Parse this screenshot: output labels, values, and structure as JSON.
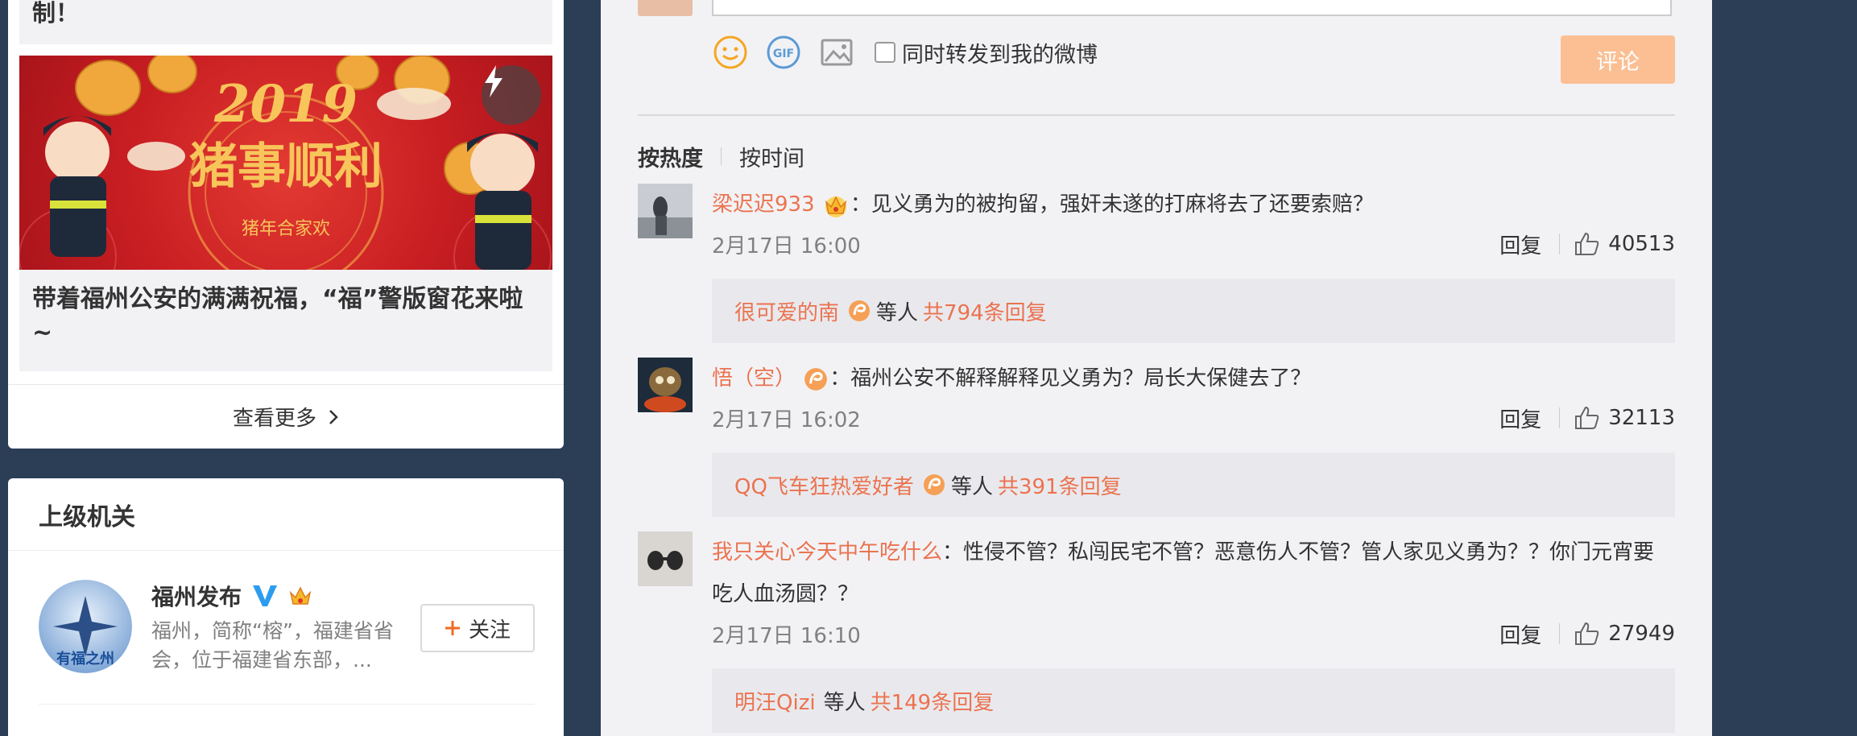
{
  "left": {
    "prev_title": "制！",
    "banner_caption": "带着福州公安的满满祝福，“福”警版窗花来啦~",
    "banner_art": {
      "year": "2019",
      "slogan": "猪事顺利",
      "sub": "猪年合家欢"
    },
    "more_label": "查看更多",
    "superior": {
      "header": "上级机关",
      "name": "福州发布",
      "desc": "福州，简称“榕”，福建省省会，位于福建省东部，...",
      "follow_label": "关注",
      "avatar_caption": "有福之州"
    }
  },
  "composer": {
    "repost_label": "同时转发到我的微博",
    "submit_label": "评论",
    "icons": [
      "smiley-icon",
      "gif-icon",
      "image-icon"
    ]
  },
  "sort": {
    "hot": "按热度",
    "time": "按时间"
  },
  "comments": [
    {
      "user": "梁迟迟933",
      "text": "：见义勇为的被拘留，强奸未遂的打麻将去了还要索赔？",
      "time": "2月17日 16:00",
      "reply_label": "回复",
      "likes": "40513",
      "sub_user": "很可爱的南",
      "sub_mid": "等人",
      "sub_count": "共794条回复"
    },
    {
      "user": "悟（空）",
      "text": "：福州公安不解释解释见义勇为？局长大保健去了？",
      "time": "2月17日 16:02",
      "reply_label": "回复",
      "likes": "32113",
      "sub_user": "QQ飞车狂热爱好者",
      "sub_mid": "等人",
      "sub_count": "共391条回复"
    },
    {
      "user": "我只关心今天中午吃什么",
      "text": "：性侵不管？私闯民宅不管？恶意伤人不管？管人家见义勇为？？你门元宵要吃人血汤圆？？",
      "time": "2月17日 16:10",
      "reply_label": "回复",
      "likes": "27949",
      "sub_user": "明汪Qizi",
      "sub_mid": "等人",
      "sub_count": "共149条回复"
    }
  ],
  "colors": {
    "accent": "#eb7350",
    "submit_disabled": "#fbbf93",
    "page_bg": "#2b3e55",
    "feed_bg": "#f2f2f5"
  }
}
